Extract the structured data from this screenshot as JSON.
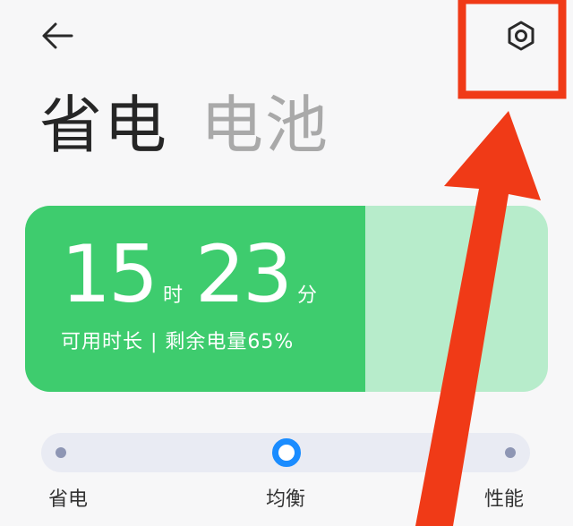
{
  "header": {
    "back_icon": "back-arrow-icon",
    "settings_icon": "gear-icon"
  },
  "tabs": [
    {
      "label": "省电",
      "active": true
    },
    {
      "label": "电池",
      "active": false
    }
  ],
  "battery_card": {
    "hours": "15",
    "hours_unit": "时",
    "minutes": "23",
    "minutes_unit": "分",
    "subtitle": "可用时长 | 剩余电量65%",
    "level_fraction": 0.65,
    "fill_color": "#3ecc6e",
    "track_color": "#b7eccb"
  },
  "mode_slider": {
    "options": [
      "省电",
      "均衡",
      "性能"
    ],
    "selected": "均衡",
    "accent_color": "#1a8cff"
  },
  "annotation": {
    "color": "#f03a17"
  }
}
